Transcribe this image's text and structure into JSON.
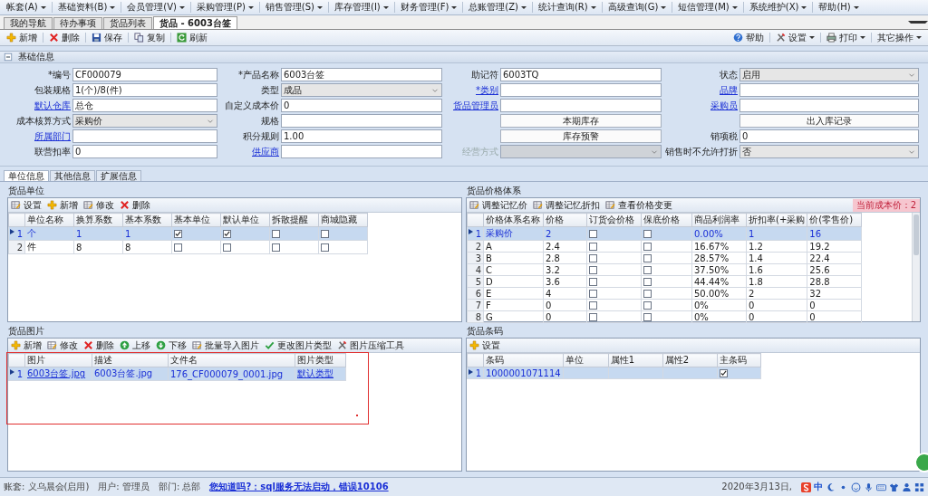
{
  "menu_bar": [
    "帐套(A)",
    "基础资料(B)",
    "会员管理(V)",
    "采购管理(P)",
    "销售管理(S)",
    "库存管理(I)",
    "财务管理(F)",
    "总账管理(Z)",
    "统计查询(R)",
    "高级查询(G)",
    "短信管理(M)",
    "系统维护(X)",
    "帮助(H)"
  ],
  "doc_tabs": [
    {
      "label": "我的导航",
      "selected": false
    },
    {
      "label": "待办事项",
      "selected": false
    },
    {
      "label": "货品列表",
      "selected": false
    },
    {
      "label": "货品 - 6003台签",
      "selected": true
    }
  ],
  "toolbar": {
    "left": [
      {
        "kind": "add",
        "label": "新增"
      },
      {
        "kind": "delete",
        "label": "删除"
      },
      {
        "kind": "save",
        "label": "保存"
      },
      {
        "kind": "copy",
        "label": "复制"
      },
      {
        "kind": "refresh",
        "label": "刷新"
      }
    ],
    "right": [
      {
        "kind": "help",
        "label": "帮助",
        "dropdown": false
      },
      {
        "kind": "tools",
        "label": "设置",
        "dropdown": true
      },
      {
        "kind": "print",
        "label": "打印",
        "dropdown": true
      },
      {
        "kind": "none",
        "label": "其它操作",
        "dropdown": true
      }
    ]
  },
  "section": {
    "title": "基础信息",
    "expanded": true
  },
  "form": {
    "rows": [
      [
        {
          "label": "*编号",
          "link": false,
          "kind": "input",
          "value": "CF000079",
          "disabled": false
        },
        {
          "label": "*产品名称",
          "link": false,
          "kind": "input",
          "value": "6003台签",
          "disabled": false
        },
        {
          "label": "助记符",
          "link": false,
          "kind": "input",
          "value": "6003TQ",
          "disabled": false
        },
        {
          "label": "状态",
          "link": false,
          "kind": "select",
          "value": "启用",
          "disabled": false
        }
      ],
      [
        {
          "label": "包装规格",
          "link": false,
          "kind": "input",
          "value": "1(个)/8(件)",
          "disabled": false
        },
        {
          "label": "类型",
          "link": false,
          "kind": "select",
          "value": "成品",
          "disabled": false
        },
        {
          "label": "*类别",
          "link": true,
          "kind": "input",
          "disabled": false
        },
        {
          "label": "品牌",
          "link": true,
          "kind": "input",
          "disabled": false
        }
      ],
      [
        {
          "label": "默认仓库",
          "link": true,
          "kind": "input",
          "value": "总仓",
          "disabled": false
        },
        {
          "label": "自定义成本价",
          "link": false,
          "kind": "input",
          "value": "0",
          "disabled": false
        },
        {
          "label": "货品管理员",
          "link": true,
          "kind": "input",
          "disabled": false
        },
        {
          "label": "采购员",
          "link": true,
          "kind": "input",
          "disabled": false
        }
      ],
      [
        {
          "label": "成本核算方式",
          "link": false,
          "kind": "select",
          "value": "采购价",
          "disabled": false
        },
        {
          "label": "规格",
          "link": false,
          "kind": "input",
          "disabled": false
        },
        {
          "kind": "button",
          "label": "本期库存"
        },
        {
          "kind": "button",
          "label": "出入库记录"
        }
      ],
      [
        {
          "label": "所属部门",
          "link": true,
          "kind": "input",
          "disabled": false
        },
        {
          "label": "积分规则",
          "link": false,
          "kind": "input",
          "value": "1.00",
          "disabled": false
        },
        {
          "kind": "button",
          "label": "库存预警"
        },
        {
          "label": "销项税",
          "link": false,
          "kind": "input",
          "value": "0",
          "disabled": false
        }
      ],
      [
        {
          "label": "联营扣率",
          "link": false,
          "kind": "input",
          "value": "0",
          "disabled": false
        },
        {
          "label": "供应商",
          "link": true,
          "kind": "input",
          "disabled": false
        },
        {
          "label": "经营方式",
          "link": false,
          "kind": "select",
          "disabled": true
        },
        {
          "label": "销售时不允许打折",
          "link": false,
          "kind": "select",
          "value": "否",
          "disabled": false
        }
      ]
    ]
  },
  "detail_tabs": [
    {
      "label": "单位信息",
      "selected": true
    },
    {
      "label": "其他信息",
      "selected": false
    },
    {
      "label": "扩展信息",
      "selected": false
    }
  ],
  "units": {
    "title": "货品单位",
    "toolbar": [
      {
        "kind": "grid",
        "label": "设置"
      },
      {
        "kind": "add",
        "label": "新增"
      },
      {
        "kind": "grid",
        "label": "修改"
      },
      {
        "kind": "delete",
        "label": "删除"
      }
    ],
    "columns": [
      "单位名称",
      "换算系数",
      "基本系数",
      "基本单位",
      "默认单位",
      "拆散提醒",
      "商城隐藏"
    ],
    "rows": [
      {
        "num": "1",
        "selected": true,
        "cells": [
          {
            "kind": "text",
            "text": "个"
          },
          {
            "kind": "text",
            "text": "1"
          },
          {
            "kind": "text",
            "text": "1"
          },
          {
            "kind": "check",
            "checked": true
          },
          {
            "kind": "check",
            "checked": true
          },
          {
            "kind": "check",
            "checked": false
          },
          {
            "kind": "check",
            "checked": false
          }
        ]
      },
      {
        "num": "2",
        "selected": false,
        "cells": [
          {
            "kind": "text",
            "text": "件"
          },
          {
            "kind": "text",
            "text": "8"
          },
          {
            "kind": "text",
            "text": "8"
          },
          {
            "kind": "check",
            "checked": false
          },
          {
            "kind": "check",
            "checked": false
          },
          {
            "kind": "check",
            "checked": false
          },
          {
            "kind": "check",
            "checked": false
          }
        ]
      }
    ]
  },
  "prices": {
    "title": "货品价格体系",
    "toolbar": [
      {
        "kind": "grid",
        "label": "调整记忆价"
      },
      {
        "kind": "grid",
        "label": "调整记忆折扣"
      },
      {
        "kind": "grid",
        "label": "查看价格变更"
      }
    ],
    "badge": "当前成本价：2",
    "columns": [
      "价格体系名称",
      "价格",
      "订货会价格",
      "保底价格",
      "商品利润率",
      "折扣率(+采购",
      "价(零售价)"
    ],
    "rows": [
      {
        "num": "1",
        "selected": true,
        "cells": [
          {
            "kind": "text",
            "text": "采购价"
          },
          {
            "kind": "text",
            "text": "2"
          },
          {
            "kind": "check",
            "checked": false
          },
          {
            "kind": "check",
            "checked": false
          },
          {
            "kind": "text",
            "text": "0.00%"
          },
          {
            "kind": "text",
            "text": "1"
          },
          {
            "kind": "text",
            "text": "16"
          }
        ]
      },
      {
        "num": "2",
        "selected": false,
        "cells": [
          {
            "kind": "text",
            "text": "A"
          },
          {
            "kind": "text",
            "text": "2.4"
          },
          {
            "kind": "check",
            "checked": false
          },
          {
            "kind": "check",
            "checked": false
          },
          {
            "kind": "text",
            "text": "16.67%"
          },
          {
            "kind": "text",
            "text": "1.2"
          },
          {
            "kind": "text",
            "text": "19.2"
          }
        ]
      },
      {
        "num": "3",
        "selected": false,
        "cells": [
          {
            "kind": "text",
            "text": "B"
          },
          {
            "kind": "text",
            "text": "2.8"
          },
          {
            "kind": "check",
            "checked": false
          },
          {
            "kind": "check",
            "checked": false
          },
          {
            "kind": "text",
            "text": "28.57%"
          },
          {
            "kind": "text",
            "text": "1.4"
          },
          {
            "kind": "text",
            "text": "22.4"
          }
        ]
      },
      {
        "num": "4",
        "selected": false,
        "cells": [
          {
            "kind": "text",
            "text": "C"
          },
          {
            "kind": "text",
            "text": "3.2"
          },
          {
            "kind": "check",
            "checked": false
          },
          {
            "kind": "check",
            "checked": false
          },
          {
            "kind": "text",
            "text": "37.50%"
          },
          {
            "kind": "text",
            "text": "1.6"
          },
          {
            "kind": "text",
            "text": "25.6"
          }
        ]
      },
      {
        "num": "5",
        "selected": false,
        "cells": [
          {
            "kind": "text",
            "text": "D"
          },
          {
            "kind": "text",
            "text": "3.6"
          },
          {
            "kind": "check",
            "checked": false
          },
          {
            "kind": "check",
            "checked": false
          },
          {
            "kind": "text",
            "text": "44.44%"
          },
          {
            "kind": "text",
            "text": "1.8"
          },
          {
            "kind": "text",
            "text": "28.8"
          }
        ]
      },
      {
        "num": "6",
        "selected": false,
        "cells": [
          {
            "kind": "text",
            "text": "E"
          },
          {
            "kind": "text",
            "text": "4"
          },
          {
            "kind": "check",
            "checked": false
          },
          {
            "kind": "check",
            "checked": false
          },
          {
            "kind": "text",
            "text": "50.00%"
          },
          {
            "kind": "text",
            "text": "2"
          },
          {
            "kind": "text",
            "text": "32"
          }
        ]
      },
      {
        "num": "7",
        "selected": false,
        "cells": [
          {
            "kind": "text",
            "text": "F"
          },
          {
            "kind": "text",
            "text": "0"
          },
          {
            "kind": "check",
            "checked": false
          },
          {
            "kind": "check",
            "checked": false
          },
          {
            "kind": "text",
            "text": "0%"
          },
          {
            "kind": "text",
            "text": "0"
          },
          {
            "kind": "text",
            "text": "0"
          }
        ]
      },
      {
        "num": "8",
        "selected": false,
        "cells": [
          {
            "kind": "text",
            "text": "G"
          },
          {
            "kind": "text",
            "text": "0"
          },
          {
            "kind": "check",
            "checked": false
          },
          {
            "kind": "check",
            "checked": false
          },
          {
            "kind": "text",
            "text": "0%"
          },
          {
            "kind": "text",
            "text": "0"
          },
          {
            "kind": "text",
            "text": "0"
          }
        ]
      }
    ]
  },
  "images": {
    "title": "货品图片",
    "toolbar": [
      {
        "kind": "add",
        "label": "新增"
      },
      {
        "kind": "grid",
        "label": "修改"
      },
      {
        "kind": "delete",
        "label": "删除"
      },
      {
        "kind": "up",
        "label": "上移"
      },
      {
        "kind": "down",
        "label": "下移"
      },
      {
        "kind": "grid",
        "label": "批量导入图片"
      },
      {
        "kind": "check",
        "label": "更改图片类型"
      },
      {
        "kind": "tools",
        "label": "图片压缩工具"
      }
    ],
    "columns": [
      "图片",
      "描述",
      "文件名",
      "图片类型"
    ],
    "rows": [
      {
        "num": "1",
        "selected": true,
        "cells": [
          {
            "kind": "link",
            "text": "6003台签.jpg"
          },
          {
            "kind": "text",
            "text": "6003台签.jpg"
          },
          {
            "kind": "text",
            "text": "176_CF000079_0001.jpg"
          },
          {
            "kind": "link",
            "text": "默认类型"
          }
        ]
      }
    ]
  },
  "barcodes": {
    "title": "货品条码",
    "toolbar": [
      {
        "kind": "add",
        "label": "设置"
      }
    ],
    "columns": [
      "条码",
      "单位",
      "属性1",
      "属性2",
      "主条码"
    ],
    "rows": [
      {
        "num": "1",
        "selected": true,
        "cells": [
          {
            "kind": "text",
            "text": "1000001071114"
          },
          {
            "kind": "text",
            "text": ""
          },
          {
            "kind": "text",
            "text": ""
          },
          {
            "kind": "text",
            "text": ""
          },
          {
            "kind": "check",
            "checked": true
          }
        ]
      }
    ]
  },
  "status_bar": {
    "account": "账套: 义乌晨会(启用)",
    "user": "用户: 管理员",
    "department": "部门: 总部",
    "tip": "您知道吗?：sql服务无法启动，错误10106",
    "date": "2020年3月13日,",
    "ime_mode": "中"
  }
}
